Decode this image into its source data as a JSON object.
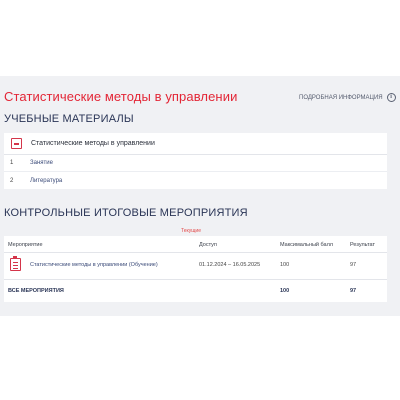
{
  "course": {
    "title": "Статистические методы в управлении",
    "more_info": "ПОДРОБНАЯ ИНФОРМАЦИЯ",
    "info_glyph": "i"
  },
  "materials": {
    "section_title": "УЧЕБНЫЕ МАТЕРИАЛЫ",
    "card_title": "Статистические методы в управлении",
    "rows": [
      {
        "num": "1",
        "label": "Занятие"
      },
      {
        "num": "2",
        "label": "Литература"
      }
    ]
  },
  "events": {
    "section_title": "КОНТРОЛЬНЫЕ ИТОГОВЫЕ МЕРОПРИЯТИЯ",
    "tab_current": "Текущие",
    "headers": {
      "event": "Мероприятие",
      "access": "Доступ",
      "max_score": "Максимальный балл",
      "result": "Результат"
    },
    "rows": [
      {
        "event": "Статистические методы в управлении (Обучение)",
        "access": "01.12.2024 – 16.05.2025",
        "max_score": "100",
        "result": "97"
      }
    ],
    "total": {
      "label": "ВСЕ МЕРОПРИЯТИЯ",
      "max_score": "100",
      "result": "97"
    }
  },
  "colors": {
    "accent_red": "#e32636",
    "heading_navy": "#2a3556",
    "link_blue": "#3a4a78",
    "page_bg": "#f0f1f4"
  }
}
